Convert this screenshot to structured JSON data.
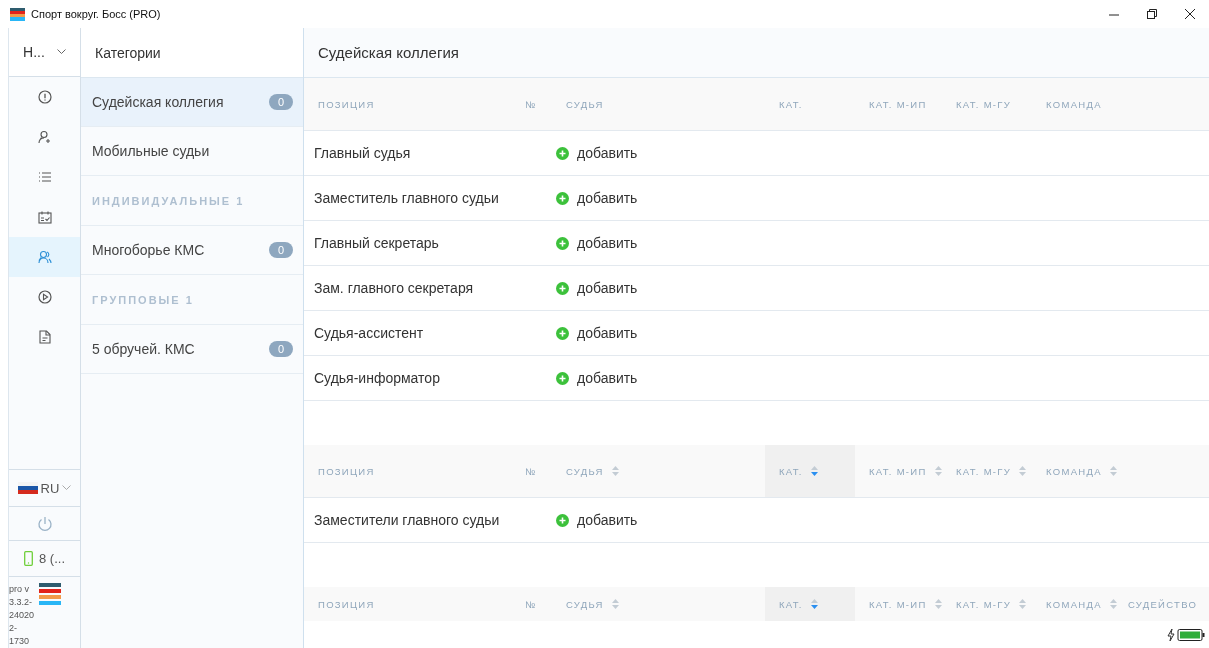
{
  "window": {
    "title": "Спорт вокруг. Босс (PRO)"
  },
  "rail": {
    "header": "Н...",
    "items": [
      {
        "kind": "info",
        "selected": false
      },
      {
        "kind": "user-add",
        "selected": false
      },
      {
        "kind": "list",
        "selected": false
      },
      {
        "kind": "calendar",
        "selected": false
      },
      {
        "kind": "users",
        "selected": true
      },
      {
        "kind": "play",
        "selected": false
      },
      {
        "kind": "document",
        "selected": false
      }
    ],
    "language": "RU",
    "devices": "8 (...",
    "version": "pro v 3.3.2-240202-1730"
  },
  "categories": {
    "title": "Категории",
    "items": [
      {
        "kind": "item",
        "label": "Судейская коллегия",
        "count": "0",
        "selected": true
      },
      {
        "kind": "item",
        "label": "Мобильные судьи",
        "selected": false
      },
      {
        "kind": "group",
        "label": "ИНДИВИДУАЛЬНЫЕ 1"
      },
      {
        "kind": "item",
        "label": "Многоборье КМС",
        "count": "0",
        "selected": false
      },
      {
        "kind": "group",
        "label": "ГРУППОВЫЕ 1"
      },
      {
        "kind": "item",
        "label": "5 обручей. КМС",
        "count": "0",
        "selected": false
      }
    ]
  },
  "main": {
    "title": "Судейская коллегия",
    "tables": [
      {
        "columns": [
          {
            "label": "ПОЗИЦИЯ",
            "sortable": false
          },
          {
            "label": "№",
            "sortable": false
          },
          {
            "label": "СУДЬЯ",
            "sortable": false
          },
          {
            "label": "КАТ.",
            "sortable": false
          },
          {
            "label": "КАТ. М-ИП",
            "sortable": false
          },
          {
            "label": "КАТ. М-ГУ",
            "sortable": false
          },
          {
            "label": "КОМАНДА",
            "sortable": false
          }
        ],
        "rows": [
          {
            "position": "Главный судья",
            "action": "добавить"
          },
          {
            "position": "Заместитель главного судьи",
            "action": "добавить"
          },
          {
            "position": "Главный секретарь",
            "action": "добавить"
          },
          {
            "position": "Зам. главного секретаря",
            "action": "добавить"
          },
          {
            "position": "Судья-ассистент",
            "action": "добавить"
          },
          {
            "position": "Судья-информатор",
            "action": "добавить"
          }
        ]
      },
      {
        "columns": [
          {
            "label": "ПОЗИЦИЯ",
            "sortable": false
          },
          {
            "label": "№",
            "sortable": false
          },
          {
            "label": "СУДЬЯ",
            "sortable": true,
            "sorted": false
          },
          {
            "label": "КАТ.",
            "sortable": true,
            "sorted": true
          },
          {
            "label": "КАТ. М-ИП",
            "sortable": true,
            "sorted": false
          },
          {
            "label": "КАТ. М-ГУ",
            "sortable": true,
            "sorted": false
          },
          {
            "label": "КОМАНДА",
            "sortable": true,
            "sorted": false
          }
        ],
        "rows": [
          {
            "position": "Заместители главного судьи",
            "action": "добавить"
          }
        ]
      },
      {
        "columns": [
          {
            "label": "ПОЗИЦИЯ",
            "sortable": false
          },
          {
            "label": "№",
            "sortable": false
          },
          {
            "label": "СУДЬЯ",
            "sortable": true,
            "sorted": false
          },
          {
            "label": "КАТ.",
            "sortable": true,
            "sorted": true
          },
          {
            "label": "КАТ. М-ИП",
            "sortable": true,
            "sorted": false
          },
          {
            "label": "КАТ. М-ГУ",
            "sortable": true,
            "sorted": false
          },
          {
            "label": "КОМАНДА",
            "sortable": true,
            "sorted": false
          },
          {
            "label": "СУДЕЙСТВО",
            "sortable": false
          }
        ]
      }
    ]
  }
}
